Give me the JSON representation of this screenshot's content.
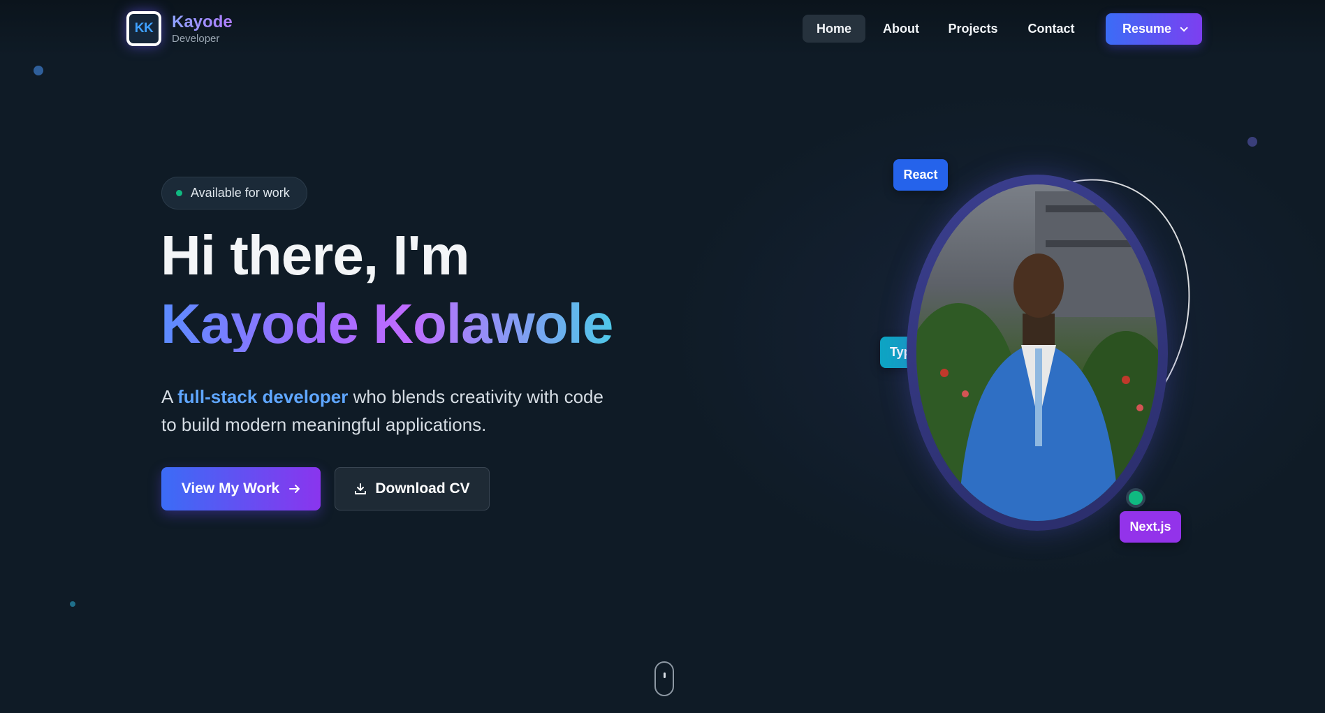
{
  "header": {
    "logo_text": "KK",
    "brand_name": "Kayode",
    "brand_subtitle": "Developer",
    "nav": [
      {
        "label": "Home",
        "active": true
      },
      {
        "label": "About",
        "active": false
      },
      {
        "label": "Projects",
        "active": false
      },
      {
        "label": "Contact",
        "active": false
      }
    ],
    "resume_label": "Resume",
    "resume_icon": "chevron-down-icon"
  },
  "hero": {
    "status_badge": "Available for work",
    "greeting": "Hi there, I'm",
    "name": "Kayode Kolawole",
    "lead_prefix": "A ",
    "lead_highlight": "full-stack developer",
    "lead_suffix": " who blends creativity with code to build modern meaningful applications.",
    "primary_button": "View My Work",
    "primary_button_icon": "arrow-right-icon",
    "secondary_button": "Download CV",
    "secondary_button_icon": "download-icon"
  },
  "profile": {
    "tags": [
      "React",
      "Typ",
      "Next.js"
    ],
    "online_indicator": "online-status"
  },
  "colors": {
    "background": "#0f1b26",
    "accent_blue": "#3b6cf6",
    "accent_purple": "#8a35ee",
    "status_green": "#10b981",
    "highlight_text": "#5fa6ff",
    "tag_react": "#2563eb",
    "tag_typescript": "#0ea5c4",
    "tag_next": "#9333ea"
  }
}
